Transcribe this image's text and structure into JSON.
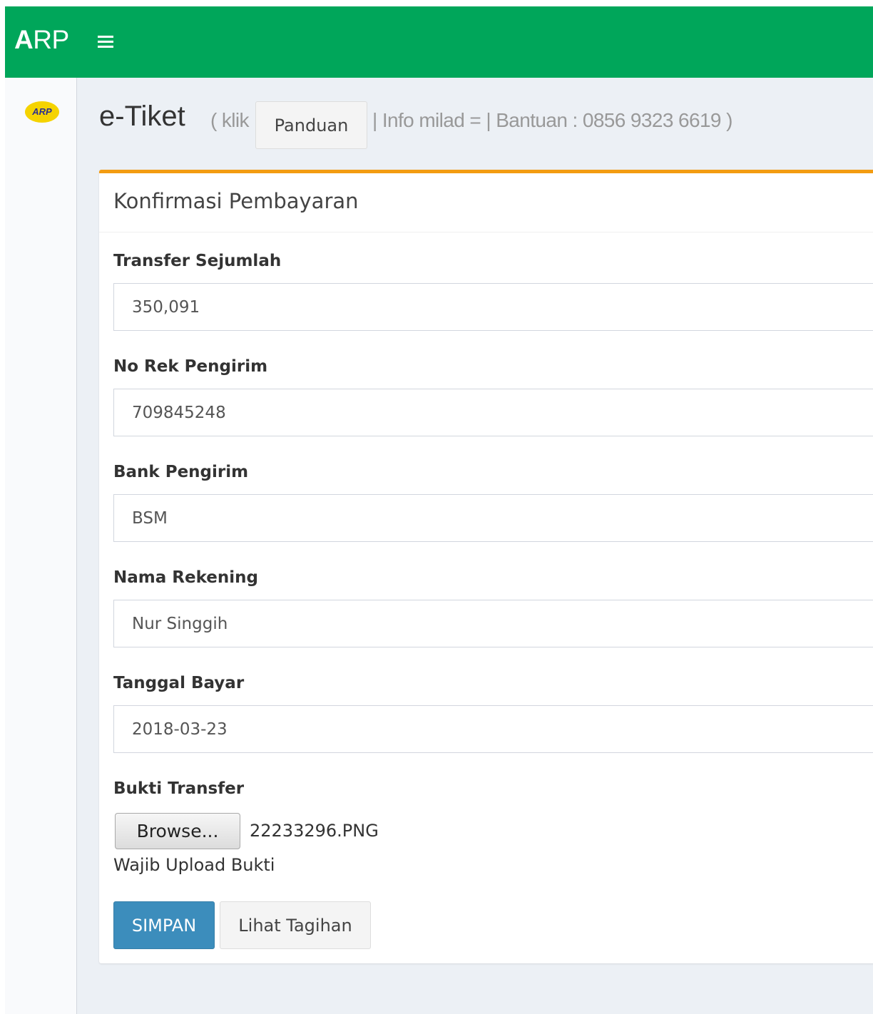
{
  "navbar": {
    "brand_bold": "A",
    "brand_rest": "RP",
    "menu_icon": "hamburger-menu-icon",
    "color": "#00a65a"
  },
  "sidebar": {
    "logo_text": "ARP"
  },
  "header": {
    "title": "e-Tiket",
    "note_before": "( klik",
    "guide_button": "Panduan",
    "note_after": "| Info milad = | Bantuan : 0856 9323 6619 )"
  },
  "form": {
    "title": "Konfirmasi Pembayaran",
    "accent_color": "#f39c12",
    "fields": [
      {
        "label": "Transfer Sejumlah",
        "value": "350,091"
      },
      {
        "label": "No Rek Pengirim",
        "value": "709845248"
      },
      {
        "label": "Bank Pengirim",
        "value": "BSM"
      },
      {
        "label": "Nama Rekening",
        "value": "Nur Singgih"
      },
      {
        "label": "Tanggal Bayar",
        "value": "2018-03-23"
      }
    ],
    "upload": {
      "label": "Bukti Transfer",
      "browse_label": "Browse...",
      "file_name": "22233296.PNG",
      "help": "Wajib Upload Bukti"
    },
    "actions": {
      "save": "SIMPAN",
      "view_bill": "Lihat Tagihan",
      "save_color": "#3c8dbc"
    }
  }
}
